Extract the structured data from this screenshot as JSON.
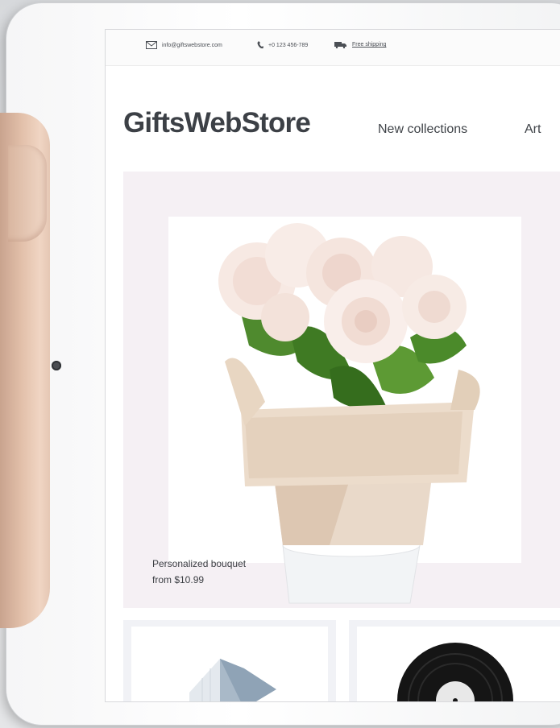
{
  "topbar": {
    "email": "info@giftswebstore.com",
    "phone": "+0 123 456-789",
    "shipping": "Free shipping"
  },
  "header": {
    "logo": "GiftsWebStore",
    "nav": [
      "New collections",
      "Art"
    ]
  },
  "hero": {
    "title": "Personalized bouquet",
    "price": "from $10.99"
  },
  "icons": [
    "envelope-icon",
    "phone-icon",
    "truck-icon",
    "camera-icon"
  ],
  "colors": {
    "hero_bg": "#f5f0f4",
    "text": "#3c4046",
    "tile_bg": "#f1f2f6"
  }
}
